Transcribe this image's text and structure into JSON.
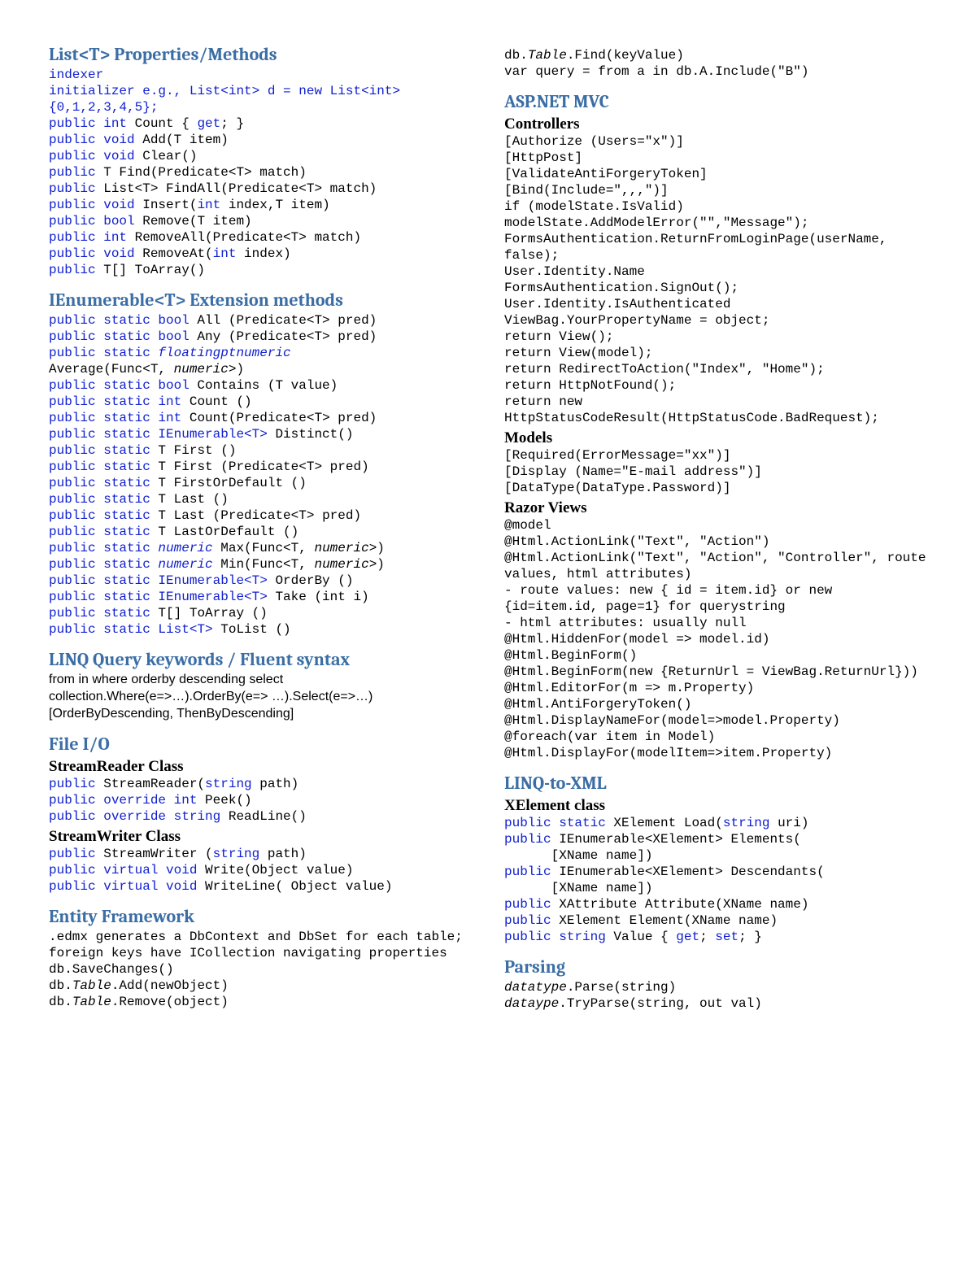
{
  "col1": {
    "h_list": "List<T> Properties/Methods",
    "list_code": "<span class=\"kw\">indexer</span>\n<span class=\"kw\">initializer e.g., List&lt;int&gt; d = new List&lt;int&gt;{0,1,2,3,4,5};</span>\n<span class=\"kw\">public int</span> Count { <span class=\"kw\">get</span>; }\n<span class=\"kw\">public void</span> Add(T item)\n<span class=\"kw\">public void</span> Clear()\n<span class=\"kw\">public</span> T Find(Predicate&lt;T&gt; match)\n<span class=\"kw\">public</span> List&lt;T&gt; FindAll(Predicate&lt;T&gt; match)\n<span class=\"kw\">public void</span> Insert(<span class=\"kw\">int</span> index,T item)\n<span class=\"kw\">public bool</span> Remove(T item)\n<span class=\"kw\">public int</span> RemoveAll(Predicate&lt;T&gt; match)\n<span class=\"kw\">public void</span> RemoveAt(<span class=\"kw\">int</span> index)\n<span class=\"kw\">public</span> T[] ToArray()",
    "h_enum": "IEnumerable<T> Extension methods",
    "enum_code": "<span class=\"kw\">public static bool</span> All (Predicate&lt;T&gt; pred)\n<span class=\"kw\">public static bool</span> Any (Predicate&lt;T&gt; pred)\n<span class=\"kw\">public static <span class=\"it\">floatingptnumeric</span></span>\nAverage(Func&lt;T, <span class=\"it\">numeric</span>&gt;)\n<span class=\"kw\">public static bool</span> Contains (T value)\n<span class=\"kw\">public static int</span> Count ()\n<span class=\"kw\">public static int</span> Count(Predicate&lt;T&gt; pred)\n<span class=\"kw\">public static IEnumerable&lt;T&gt;</span> Distinct()\n<span class=\"kw\">public static</span> T First ()\n<span class=\"kw\">public static</span> T First (Predicate&lt;T&gt; pred)\n<span class=\"kw\">public static</span> T FirstOrDefault ()\n<span class=\"kw\">public static</span> T Last ()\n<span class=\"kw\">public static</span> T Last (Predicate&lt;T&gt; pred)\n<span class=\"kw\">public static</span> T LastOrDefault ()\n<span class=\"kw\">public static <span class=\"it\">numeric</span></span> Max(Func&lt;T, <span class=\"it\">numeric</span>&gt;)\n<span class=\"kw\">public static <span class=\"it\">numeric</span></span> Min(Func&lt;T, <span class=\"it\">numeric</span>&gt;)\n<span class=\"kw\">public static IEnumerable&lt;T&gt;</span> OrderBy ()\n<span class=\"kw\">public static IEnumerable&lt;T&gt;</span> Take (int i)\n<span class=\"kw\">public static</span> T[] ToArray ()\n<span class=\"kw\">public static List&lt;T&gt;</span> ToList ()",
    "h_linq": "LINQ Query keywords / Fluent syntax",
    "linq_text": "from in where orderby descending select\ncollection.Where(e=>…).OrderBy(e=> …).Select(e=>…)\n[OrderByDescending, ThenByDescending]",
    "h_file": "File I/O",
    "h_sr": "StreamReader Class",
    "sr_code": "<span class=\"kw\">public</span> StreamReader(<span class=\"kw\">string</span> path)\n<span class=\"kw\">public override int</span> Peek()\n<span class=\"kw\">public override string</span> ReadLine()",
    "h_sw": "StreamWriter Class",
    "sw_code": "<span class=\"kw\">public</span> StreamWriter (<span class=\"kw\">string</span> path)\n<span class=\"kw\">public virtual void</span> Write(Object value)\n<span class=\"kw\">public virtual void</span> WriteLine( Object value)",
    "h_ef": "Entity Framework",
    "ef_code": ".edmx generates a DbContext and DbSet for each table; foreign keys have ICollection navigating properties\ndb.SaveChanges()\ndb.<span class=\"it\">Table</span>.Add(newObject)\ndb.<span class=\"it\">Table</span>.Remove(object)"
  },
  "col2": {
    "ef_cont": "db.<span class=\"it\">Table</span>.Find(keyValue)\nvar query = from a in db.A.Include(\"B\")",
    "h_mvc": "ASP.NET MVC",
    "h_ctrl": "Controllers",
    "ctrl_code": "[Authorize (Users=\"x\")]\n[HttpPost]\n[ValidateAntiForgeryToken]\n[Bind(Include=\",,,\")]\nif (modelState.IsValid)\nmodelState.AddModelError(\"\",\"Message\");\nFormsAuthentication.ReturnFromLoginPage(userName, false);\nUser.Identity.Name\nFormsAuthentication.SignOut();\nUser.Identity.IsAuthenticated\nViewBag.YourPropertyName = object;\nreturn View();\nreturn View(model);\nreturn RedirectToAction(\"Index\", \"Home\");\nreturn HttpNotFound();\nreturn new HttpStatusCodeResult(HttpStatusCode.BadRequest);",
    "h_models": "Models",
    "models_code": "[Required(ErrorMessage=\"xx\")]\n[Display (Name=\"E-mail address\")]\n[DataType(DataType.Password)]",
    "h_razor": "Razor Views",
    "razor_code": "@model\n@Html.ActionLink(\"Text\", \"Action\")\n@Html.ActionLink(\"Text\", \"Action\", \"Controller\", route values, html attributes)\n- route values: new { id = item.id} or new {id=item.id, page=1} for querystring\n- html attributes: usually null\n@Html.HiddenFor(model => model.id)\n@Html.BeginForm()\n@Html.BeginForm(new {ReturnUrl = ViewBag.ReturnUrl}))\n@Html.EditorFor(m => m.Property)\n@Html.AntiForgeryToken()\n@Html.DisplayNameFor(model=>model.Property)\n@foreach(var item in Model)\n@Html.DisplayFor(modelItem=>item.Property)",
    "h_l2x": "LINQ-to-XML",
    "h_xelem": "XElement class",
    "xelem_code": "<span class=\"kw\">public static</span> XElement Load(<span class=\"kw\">string</span> uri)\n<span class=\"kw\">public</span> IEnumerable&lt;XElement&gt; Elements(\n      [XName name])\n<span class=\"kw\">public</span> IEnumerable&lt;XElement&gt; Descendants(\n      [XName name])\n<span class=\"kw\">public</span> XAttribute Attribute(XName name)\n<span class=\"kw\">public</span> XElement Element(XName name)\n<span class=\"kw\">public string</span> Value { <span class=\"kw\">get</span>; <span class=\"kw\">set</span>; }",
    "h_parse": "Parsing",
    "parse_code": "<span class=\"it\">datatype</span>.Parse(string)\n<span class=\"it\">dataype</span>.TryParse(string, out val)"
  }
}
